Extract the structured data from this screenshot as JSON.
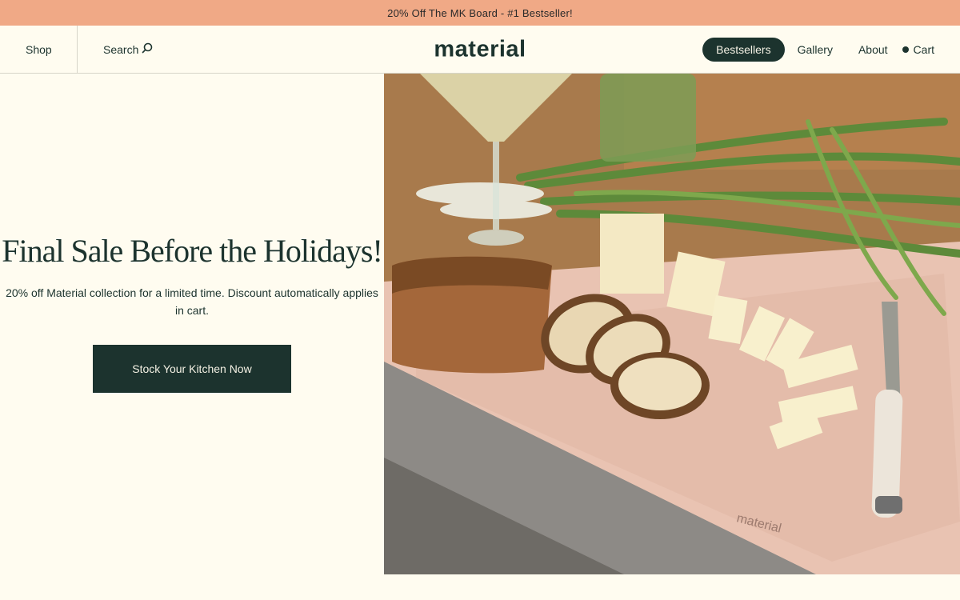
{
  "promo": {
    "text": "20% Off The MK Board - #1 Bestseller!"
  },
  "nav": {
    "shop": "Shop",
    "search": "Search",
    "logo": "material",
    "bestsellers": "Bestsellers",
    "gallery": "Gallery",
    "about": "About",
    "cart": "Cart"
  },
  "hero": {
    "title": "Final Sale Before the Holidays!",
    "subtitle": "20% off Material collection for a limited time. Discount automatically applies in cart.",
    "cta": "Stock Your Kitchen Now",
    "image_board_brand": "material"
  },
  "colors": {
    "promo_bg": "#f0a986",
    "brand_dark": "#1c332e",
    "page_bg": "#fffcf0",
    "board_pink": "#e9c3b2"
  },
  "icons": {
    "search": "search-icon",
    "cart": "cart-dot-icon"
  }
}
